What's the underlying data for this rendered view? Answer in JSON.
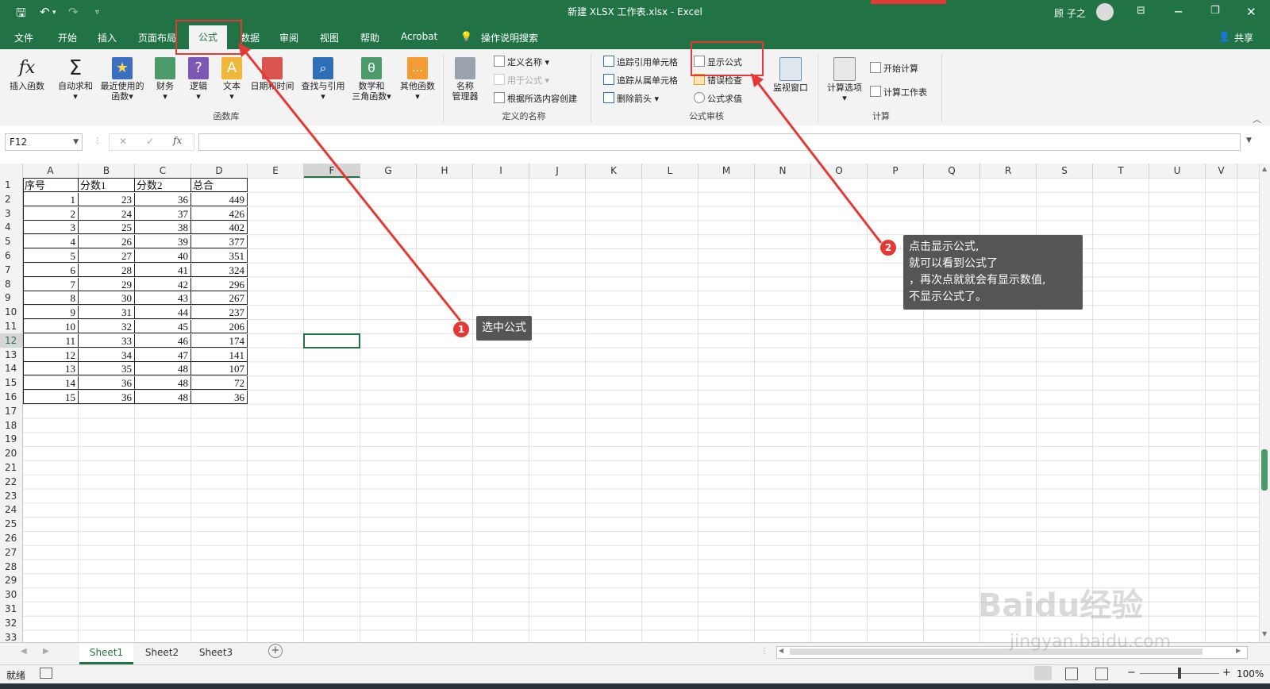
{
  "titlebar": {
    "doc_title": "新建 XLSX 工作表.xlsx",
    "app_name": "Excel",
    "user_name": "顾 子之"
  },
  "menu": {
    "tabs": [
      "文件",
      "开始",
      "插入",
      "页面布局",
      "公式",
      "数据",
      "审阅",
      "视图",
      "帮助",
      "Acrobat"
    ],
    "active_tab": "公式",
    "search_hint": "操作说明搜索",
    "share": "共享"
  },
  "ribbon": {
    "library": {
      "insert_function": "插入函数",
      "autosum": "自动求和",
      "recent": "最近使用的",
      "recent2": "函数",
      "financial": "财务",
      "logical": "逻辑",
      "text": "文本",
      "datetime": "日期和时间",
      "lookup": "查找与引用",
      "math": "数学和",
      "math2": "三角函数",
      "more": "其他函数",
      "group_label": "函数库"
    },
    "names": {
      "manager": "名称",
      "manager2": "管理器",
      "define": "定义名称",
      "use_in_formula": "用于公式",
      "create_from_selection": "根据所选内容创建",
      "group_label": "定义的名称"
    },
    "audit": {
      "trace_precedents": "追踪引用单元格",
      "trace_dependents": "追踪从属单元格",
      "remove_arrows": "删除箭头",
      "show_formulas": "显示公式",
      "error_check": "错误检查",
      "evaluate": "公式求值",
      "watch": "监视窗口",
      "group_label": "公式审核"
    },
    "calc": {
      "options": "计算选项",
      "calc_now": "开始计算",
      "calc_sheet": "计算工作表",
      "group_label": "计算"
    }
  },
  "formula_bar": {
    "name_box": "F12",
    "cancel": "✕",
    "enter": "✓",
    "fx": "fx",
    "content": ""
  },
  "grid": {
    "columns": [
      "A",
      "B",
      "C",
      "D",
      "E",
      "F",
      "G",
      "H",
      "I",
      "J",
      "K",
      "L",
      "M",
      "N",
      "O",
      "P",
      "Q",
      "R",
      "S",
      "T",
      "U",
      "V"
    ],
    "rows": [
      "1",
      "2",
      "3",
      "4",
      "5",
      "6",
      "7",
      "8",
      "9",
      "10",
      "11",
      "12",
      "13",
      "14",
      "15",
      "16",
      "17",
      "18",
      "19",
      "20",
      "21",
      "22",
      "23",
      "24",
      "25",
      "26",
      "27",
      "28",
      "29",
      "30",
      "31",
      "32",
      "33"
    ],
    "headers": [
      "序号",
      "分数1",
      "分数2",
      "总合"
    ],
    "data": [
      [
        "1",
        "23",
        "36",
        "449"
      ],
      [
        "2",
        "24",
        "37",
        "426"
      ],
      [
        "3",
        "25",
        "38",
        "402"
      ],
      [
        "4",
        "26",
        "39",
        "377"
      ],
      [
        "5",
        "27",
        "40",
        "351"
      ],
      [
        "6",
        "28",
        "41",
        "324"
      ],
      [
        "7",
        "29",
        "42",
        "296"
      ],
      [
        "8",
        "30",
        "43",
        "267"
      ],
      [
        "9",
        "31",
        "44",
        "237"
      ],
      [
        "10",
        "32",
        "45",
        "206"
      ],
      [
        "11",
        "33",
        "46",
        "174"
      ],
      [
        "12",
        "34",
        "47",
        "141"
      ],
      [
        "13",
        "35",
        "48",
        "107"
      ],
      [
        "14",
        "36",
        "48",
        "72"
      ],
      [
        "15",
        "36",
        "48",
        "36"
      ]
    ],
    "selected_cell": "F12"
  },
  "sheets": {
    "tabs": [
      "Sheet1",
      "Sheet2",
      "Sheet3"
    ],
    "active": "Sheet1"
  },
  "status": {
    "ready": "就绪",
    "zoom": "100%"
  },
  "annotations": {
    "step1_number": "1",
    "step1_text": "选中公式",
    "step2_number": "2",
    "step2_lines": [
      "点击显示公式,",
      "就可以看到公式了",
      "，再次点就就会有显示数值,",
      "不显示公式了。"
    ],
    "annotation_color": "#e53935"
  },
  "watermark": {
    "brand": "Baidu经验",
    "url": "jingyan.baidu.com"
  },
  "colors": {
    "excel_green": "#217346",
    "ribbon_bg": "#f3f3f3"
  }
}
